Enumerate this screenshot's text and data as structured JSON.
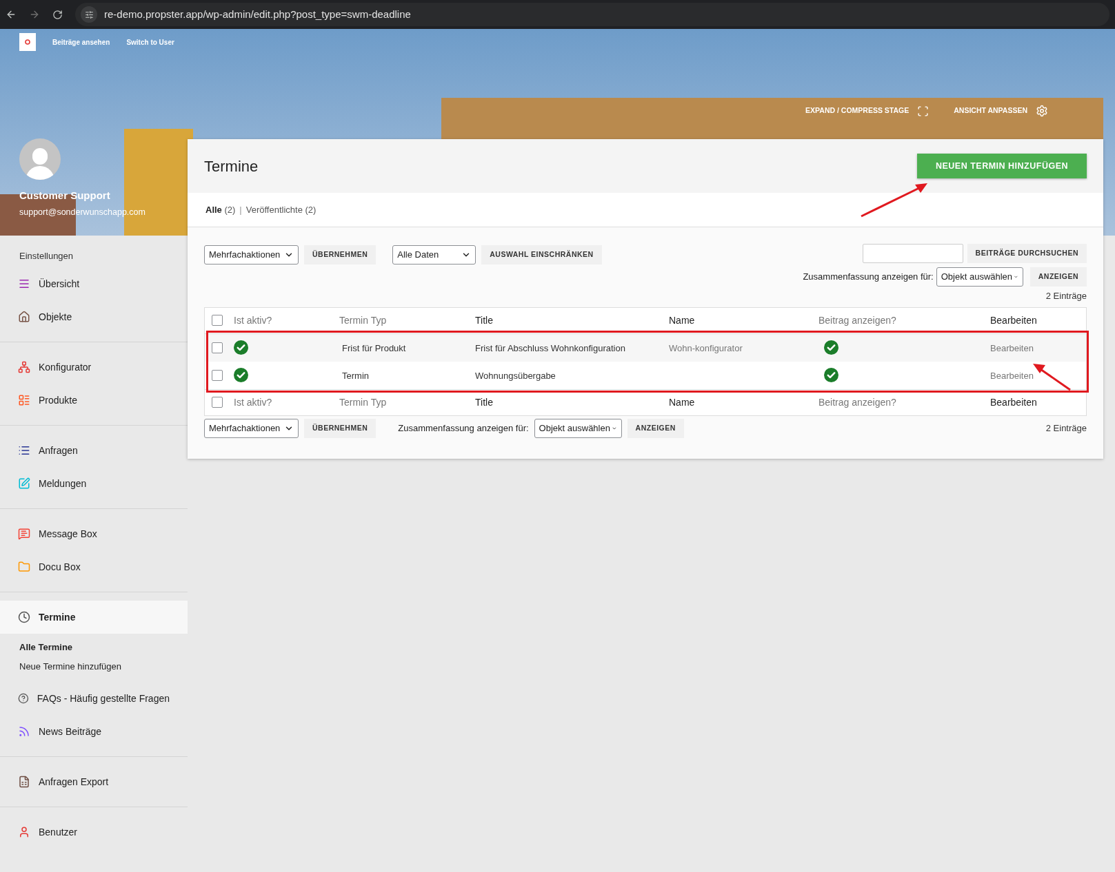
{
  "browser": {
    "url": "re-demo.propster.app/wp-admin/edit.php?post_type=swm-deadline"
  },
  "admin_bar": {
    "links": [
      "Beiträge ansehen",
      "Switch to User"
    ]
  },
  "stage_controls": [
    {
      "label": "EXPAND / COMPRESS STAGE",
      "kind": "expand"
    },
    {
      "label": "ANSICHT ANPASSEN",
      "kind": "settings"
    }
  ],
  "user": {
    "name": "Customer Support",
    "email": "support@sonderwunschapp.com"
  },
  "sidebar": {
    "heading": "Einstellungen",
    "groups": [
      [
        {
          "label": "Übersicht",
          "kind": "overview",
          "selected": false
        },
        {
          "label": "Objekte",
          "kind": "home",
          "selected": false
        }
      ],
      [
        {
          "label": "Konfigurator",
          "kind": "hierarchy",
          "selected": false
        },
        {
          "label": "Produkte",
          "kind": "products",
          "selected": false
        }
      ],
      [
        {
          "label": "Anfragen",
          "kind": "list",
          "selected": false
        },
        {
          "label": "Meldungen",
          "kind": "note",
          "selected": false
        }
      ],
      [
        {
          "label": "Message Box",
          "kind": "message",
          "selected": false
        },
        {
          "label": "Docu Box",
          "kind": "folder",
          "selected": false
        }
      ],
      [
        {
          "label": "Termine",
          "kind": "clock",
          "selected": true,
          "children": [
            {
              "label": "Alle Termine",
              "selected": true
            },
            {
              "label": "Neue Termine hinzufügen",
              "selected": false
            }
          ]
        },
        {
          "label": "FAQs - Häufig gestellte Fragen",
          "kind": "help",
          "selected": false
        },
        {
          "label": "News Beiträge",
          "kind": "rss",
          "selected": false
        }
      ],
      [
        {
          "label": "Anfragen Export",
          "kind": "export",
          "selected": false
        }
      ],
      [
        {
          "label": "Benutzer",
          "kind": "user",
          "selected": false
        }
      ]
    ]
  },
  "page": {
    "title": "Termine",
    "add_button": "NEUEN TERMIN HINZUFÜGEN",
    "views": [
      {
        "label": "Alle",
        "count": "(2)",
        "selected": true
      },
      {
        "label": "Veröffentlichte",
        "count": "(2)",
        "selected": false
      }
    ],
    "view_separator": "|",
    "top_nav": {
      "bulk_select": "Mehrfachaktionen",
      "apply": "ÜBERNEHMEN",
      "date_select": "Alle Daten",
      "filter": "AUSWAHL EINSCHRÄNKEN",
      "search_button": "BEITRÄGE DURCHSUCHEN",
      "summary_label": "Zusammenfassung anzeigen für:",
      "summary_select": "Objekt auswählen",
      "show": "ANZEIGEN",
      "count": "2 Einträge"
    },
    "table": {
      "columns": [
        {
          "label": "Ist aktiv?",
          "sortable": true
        },
        {
          "label": "Termin Typ",
          "sortable": true
        },
        {
          "label": "Title",
          "sortable": false
        },
        {
          "label": "Name",
          "sortable": false
        },
        {
          "label": "Beitrag anzeigen?",
          "sortable": true
        },
        {
          "label": "Bearbeiten",
          "sortable": false
        }
      ],
      "footer_columns": [
        {
          "label": "Ist aktiv?",
          "sortable": true
        },
        {
          "label": "Termin Typ",
          "sortable": true
        },
        {
          "label": "Title",
          "sortable": false
        },
        {
          "label": "Name",
          "sortable": false
        },
        {
          "label": "Beitrag anzeigen?",
          "sortable": true
        },
        {
          "label": "Bearbeiten",
          "sortable": false
        }
      ],
      "header_checked": false,
      "footer_checked": false,
      "rows": [
        {
          "checked": false,
          "active": true,
          "type": "Frist für Produkt",
          "title": "Frist für Abschluss Wohnkonfiguration",
          "name": "Wohn-konfigurator",
          "show_post": true,
          "edit": "Bearbeiten"
        },
        {
          "checked": false,
          "active": true,
          "type": "Termin",
          "title": "Wohnungsübergabe",
          "show_post": true,
          "edit": "Bearbeiten"
        }
      ]
    },
    "bottom_nav": {
      "bulk_select": "Mehrfachaktionen",
      "apply": "ÜBERNEHMEN",
      "summary_label": "Zusammenfassung anzeigen für:",
      "summary_select": "Objekt auswählen",
      "show": "ANZEIGEN",
      "count": "2 Einträge"
    }
  }
}
